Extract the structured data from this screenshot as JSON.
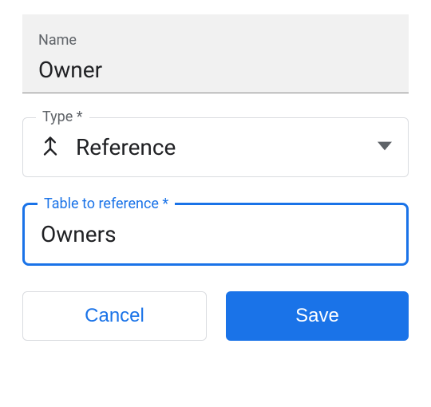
{
  "nameField": {
    "label": "Name",
    "value": "Owner"
  },
  "typeField": {
    "label": "Type *",
    "value": "Reference"
  },
  "tableField": {
    "label": "Table to reference *",
    "value": "Owners"
  },
  "buttons": {
    "cancel": "Cancel",
    "save": "Save"
  }
}
